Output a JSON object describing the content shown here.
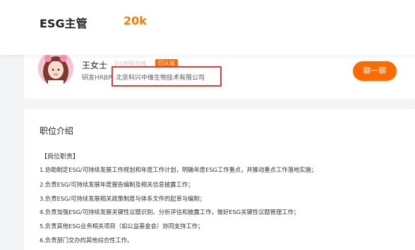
{
  "header": {
    "job_title": "ESG主管",
    "salary": "20k",
    "salary_color": "#ff7a00"
  },
  "recruiter": {
    "name": "王女士",
    "online_status": "2小时前在线",
    "verified_badge": "已认证",
    "role": "研发HRBP",
    "separator": "·",
    "company": "北京科兴中维生物技术有限公司",
    "chat_button": "聊一聊",
    "accent_color": "#ff6a00",
    "highlight_color": "#e53935"
  },
  "job_description": {
    "section_title": "职位介绍",
    "responsibilities_header": "【岗位职责】",
    "duties": [
      "1.协助制定ESG/可持续发展工作规划和年度工作计划，明确年度ESG工作重点，并推动重点工作落地实施；",
      "2.负责ESG/可持续发展年度报告编制及相关信息披露工作；",
      "3.负责ESG/可持续发展相关政策制度与体系文件的起草与编制；",
      "4.负责加强ESG/可持续发展关键性议题识别、分析评估和披露工作，做好ESG关键性议题管理工作；",
      "5.负责其他ESG业务相关项目（如公益基金会）协同支持工作；",
      "6.负责部门交办的其他综合性工作。"
    ]
  }
}
